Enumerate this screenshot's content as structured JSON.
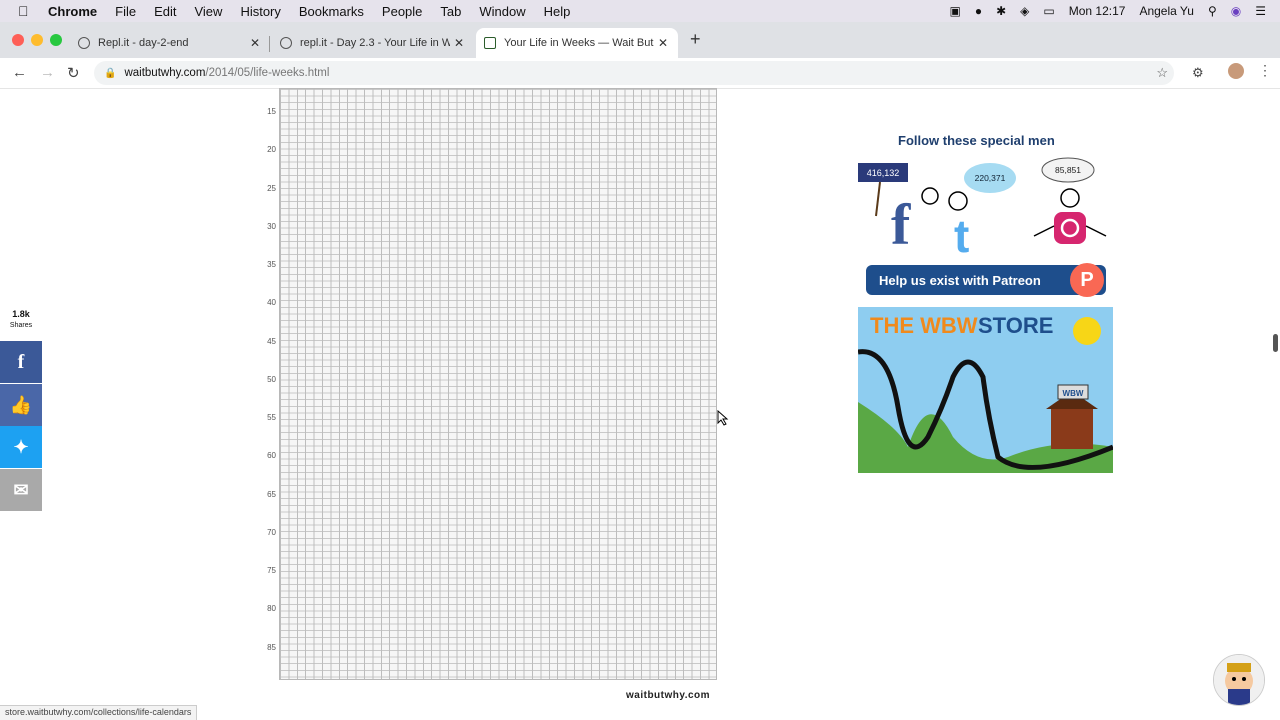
{
  "menubar": {
    "app": "Chrome",
    "items": [
      "File",
      "Edit",
      "View",
      "History",
      "Bookmarks",
      "People",
      "Tab",
      "Window",
      "Help"
    ],
    "clock": "Mon 12:17",
    "user": "Angela Yu"
  },
  "tabs": [
    {
      "title": "Repl.it - day-2-end",
      "active": false
    },
    {
      "title": "repl.it - Day 2.3 - Your Life in W",
      "active": false
    },
    {
      "title": "Your Life in Weeks — Wait But W",
      "active": true
    }
  ],
  "address": {
    "host": "waitbutwhy.com",
    "path": "/2014/05/life-weeks.html"
  },
  "chart": {
    "y_labels": [
      "15",
      "20",
      "25",
      "30",
      "35",
      "40",
      "45",
      "50",
      "55",
      "60",
      "65",
      "70",
      "75",
      "80",
      "85"
    ],
    "footer": "waitbutwhy.com"
  },
  "share": {
    "count": "1.8k",
    "label": "Shares",
    "facebook_color": "#3b5998",
    "like_color": "#4a67a8",
    "twitter_color": "#1da1f2",
    "email_color": "#a9a9a9"
  },
  "sidebar": {
    "follow_title": "Follow these special men",
    "facebook_count": "416,132",
    "twitter_count": "220,371",
    "instagram_count": "85,851",
    "patreon_label": "Help us exist with Patreon",
    "store_title_left": "THE WBW",
    "store_title_right": "STORE",
    "store_sign": "WBW"
  },
  "status_bar": {
    "url": "store.waitbutwhy.com/collections/life-calendars"
  }
}
